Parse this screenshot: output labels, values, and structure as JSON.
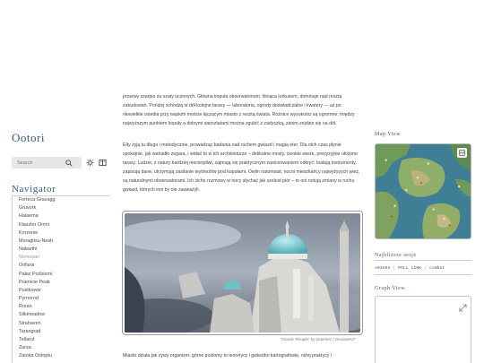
{
  "site": {
    "title": "Ootori"
  },
  "search": {
    "placeholder": "Search"
  },
  "navigator": {
    "title": "Navigator",
    "items": [
      {
        "label": "Forteca Gravagg"
      },
      {
        "label": "Gruvork"
      },
      {
        "label": "Halaema"
      },
      {
        "label": "Klasztor Omni"
      },
      {
        "label": "Korzenie"
      },
      {
        "label": "Moragitsu-Nesh"
      },
      {
        "label": "Nabarthi"
      },
      {
        "label": "Nomosan"
      },
      {
        "label": "Orifaris"
      },
      {
        "label": "Pałac Podziemi"
      },
      {
        "label": "Pramicie Peak"
      },
      {
        "label": "Pustkowie"
      },
      {
        "label": "Pyrnorod"
      },
      {
        "label": "Roran"
      },
      {
        "label": "Silkmeadow"
      },
      {
        "label": "Strahaven"
      },
      {
        "label": "Tarangrad"
      },
      {
        "label": "Tellarul"
      },
      {
        "label": "Zarsa"
      },
      {
        "label": "Zatoka Ostoptu"
      }
    ]
  },
  "article": {
    "p1": "przerwy szarpie za szaty uczonych. Główna kopuła obserwatorium, lśniąca turkusem, dominuje nad resztą zabudowań. Poniżej schodzą w dół kolejne tarasy — laboratoria, ogrody doświadczalne i kwatery — aż po niewielkie osiedla przy wąskim moście łączącym miasto z resztą świata. Różnice wysokości są ogromne; między najwyższym punktem kopuły a dolnymi warsztatami można zgubić z zadyszką, zanim zejdzie się na dół.",
    "p2": "Elty żyją tu długo i metodycznie, prowadząc badania nad ruchem gwiazd i magią eter. Dla nich czas płynie spokojnie, jak wahadło zegara, i widać to w ich architekturze – delikatne mosty, cienkie wieże, precyzyjnie ułożone tarasy. Ludzie, z natury bardziej niecierpliwi, zajmują się praktycznym zastosowaniem odkryć: budują instrumenty, zapisują dane, utrzymują zasilanie teylinežów pod kopułami. Owlin natomiast, nocni mieszkańcy najwyższych wież, są naturalnymi obserwatorami. Ich ciche rozmowy w nocy słychać jak szelest piór – to oni notują zmiany w ruchu gwiazd, których inni by nie zauważyli.",
    "p3": "Miasto działa jak żywy organizm: górne poziomy to teoretycy i gwiezdni kartografowie, niżej praktycy i",
    "caption": "\"Oracle Temple\" by Daemes / DeviantArt\""
  },
  "right": {
    "map_title": "Map View",
    "links_title": "Najbliższe sesje",
    "links": [
      {
        "label": "s03e03"
      },
      {
        "label": "POLL LINK"
      },
      {
        "label": "combat"
      }
    ],
    "graph_title": "Graph View"
  },
  "colors": {
    "accent": "#3b5c75",
    "text": "#444444",
    "rule": "#cfcfcf"
  },
  "icons": {
    "search": "search-icon",
    "theme": "sun-icon",
    "reader": "book-icon",
    "map_toggle": "map-icon",
    "graph_expand": "expand-icon"
  }
}
